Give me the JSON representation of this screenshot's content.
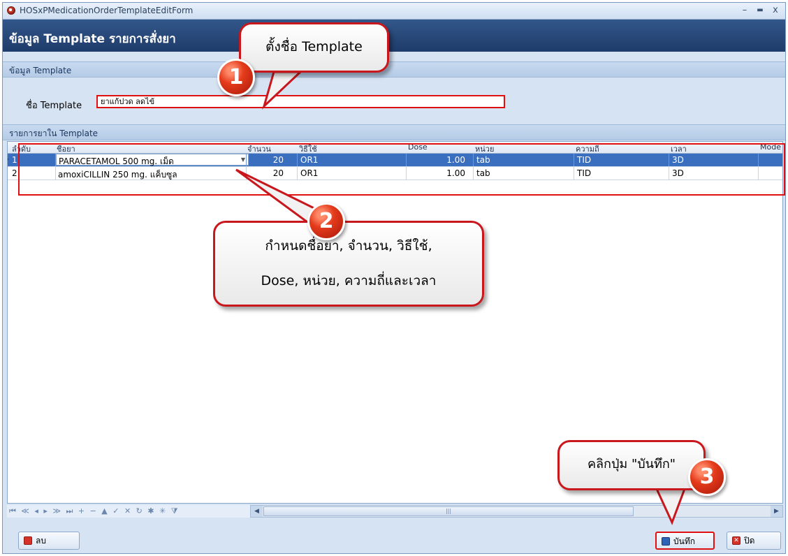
{
  "window": {
    "title": "HOSxPMedicationOrderTemplateEditForm",
    "minimize": "–",
    "maximize": "▬",
    "close": "x"
  },
  "header": {
    "title": "ข้อมูล Template รายการสั่งยา"
  },
  "template_section": {
    "label": "ข้อมูล Template",
    "name_label": "ชื่อ Template",
    "name_value": "ยาแก้ปวด ลดไข้"
  },
  "items_section": {
    "label": "รายการยาใน Template"
  },
  "grid": {
    "columns": [
      "ลำดับ",
      "ชื่อยา",
      "จำนวน",
      "วิธีใช้",
      "Dose",
      "หน่วย",
      "ความถี่",
      "เวลา",
      "Mode"
    ],
    "rows": [
      {
        "seq": "1",
        "drug": "PARACETAMOL 500 mg. เม็ด",
        "qty": "20",
        "usage": "OR1",
        "dose": "1.00",
        "unit": "tab",
        "freq": "TID",
        "time": "3D",
        "selected": true
      },
      {
        "seq": "2",
        "drug": "amoxiCILLIN 250 mg. แค็บซูล",
        "qty": "20",
        "usage": "OR1",
        "dose": "1.00",
        "unit": "tab",
        "freq": "TID",
        "time": "3D",
        "selected": false
      }
    ]
  },
  "navigator": {
    "icons": "⏮ ≪ ◂ ▸ ≫ ⏭ + − ▲ ✓ ✕ ↻ ✱ ✳ ⧩"
  },
  "buttons": {
    "delete": "ลบ",
    "save": "บันทึก",
    "close": "ปิด"
  },
  "callouts": {
    "c1_text": "ตั้งชื่อ Template",
    "c1_badge": "1",
    "c2_line1": "กำหนดชื่อยา, จำนวน, วิธีใช้,",
    "c2_line2": "Dose, หน่วย, ความถี่และเวลา",
    "c2_badge": "2",
    "c3_text": "คลิกปุ่ม \"บันทึก\"",
    "c3_badge": "3"
  },
  "colors": {
    "header_bg": "#1e3b6a",
    "selected_row": "#3a6fc0",
    "highlight_red": "#e01010"
  }
}
